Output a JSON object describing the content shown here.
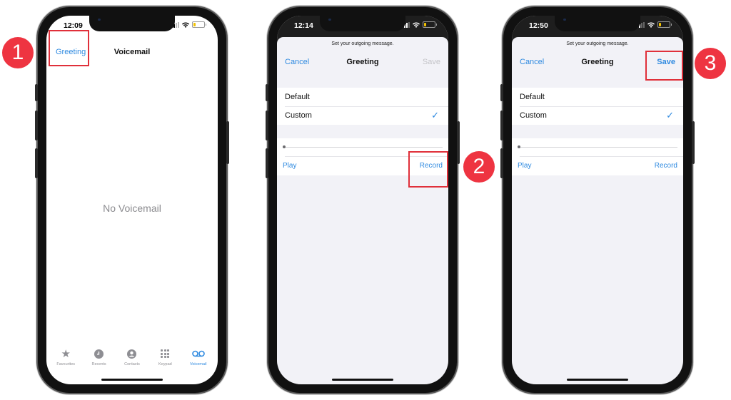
{
  "colors": {
    "accent": "#2f8ae0",
    "callout": "#e0303a",
    "badge": "#ee3441"
  },
  "phones": [
    {
      "status": {
        "time": "12:09"
      },
      "nav": {
        "left": "Greeting",
        "title": "Voicemail"
      },
      "empty_text": "No Voicemail",
      "tabs": [
        {
          "label": "Favourites",
          "icon": "star-icon"
        },
        {
          "label": "Recents",
          "icon": "clock-icon"
        },
        {
          "label": "Contacts",
          "icon": "person-icon"
        },
        {
          "label": "Keypad",
          "icon": "keypad-icon"
        },
        {
          "label": "Voicemail",
          "icon": "voicemail-icon",
          "active": true
        }
      ]
    },
    {
      "status": {
        "time": "12:14"
      },
      "prompt": "Set your outgoing message.",
      "nav": {
        "left": "Cancel",
        "title": "Greeting",
        "right": "Save",
        "right_enabled": false
      },
      "options": [
        {
          "label": "Default"
        },
        {
          "label": "Custom",
          "selected": true
        }
      ],
      "player": {
        "play": "Play",
        "record": "Record",
        "progress": 0
      }
    },
    {
      "status": {
        "time": "12:50"
      },
      "prompt": "Set your outgoing message.",
      "nav": {
        "left": "Cancel",
        "title": "Greeting",
        "right": "Save",
        "right_enabled": true
      },
      "options": [
        {
          "label": "Default"
        },
        {
          "label": "Custom",
          "selected": true
        }
      ],
      "player": {
        "play": "Play",
        "record": "Record",
        "progress": 0
      }
    }
  ],
  "steps": [
    "1",
    "2",
    "3"
  ],
  "check_glyph": "✓"
}
